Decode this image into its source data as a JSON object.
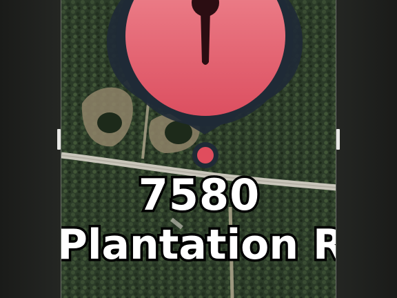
{
  "map": {
    "pin": {
      "color": "#e35d6a",
      "icon": "pin-icon"
    },
    "label": {
      "number": "7580",
      "street": "Plantation Rc"
    },
    "colors": {
      "forest": "#2d3e2a",
      "road": "#c9c6bb",
      "clearing": "#9a8f74"
    }
  }
}
